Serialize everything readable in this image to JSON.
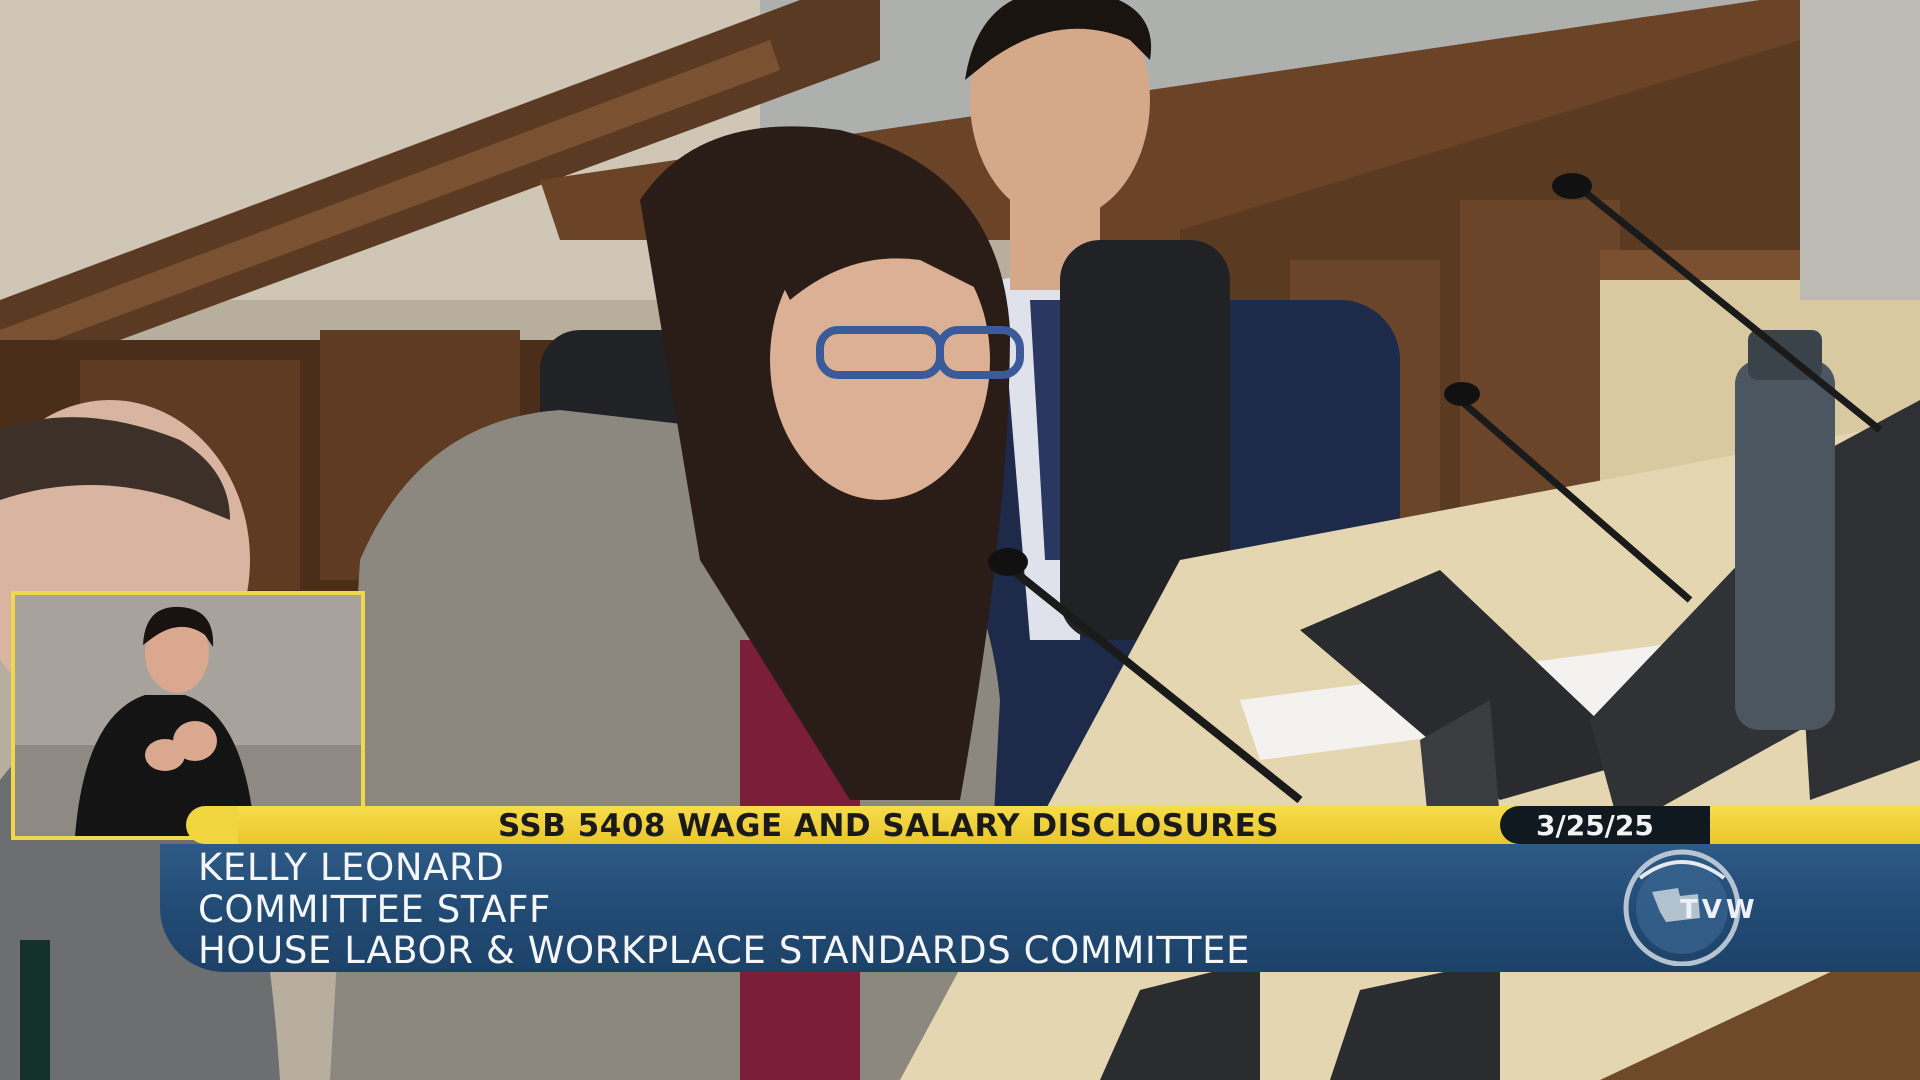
{
  "lower_third": {
    "bill_title": "SSB 5408 WAGE AND SALARY DISCLOSURES",
    "date": "3/25/25",
    "speaker_name": "KELLY LEONARD",
    "speaker_role": "COMMITTEE STAFF",
    "speaker_affiliation": "HOUSE LABOR & WORKPLACE STANDARDS COMMITTEE"
  },
  "logo": {
    "text": "TVW"
  },
  "colors": {
    "banner_yellow": "#f1d53e",
    "info_blue": "#24507b",
    "date_dark": "#101820",
    "interpreter_border": "#f0d84a"
  }
}
